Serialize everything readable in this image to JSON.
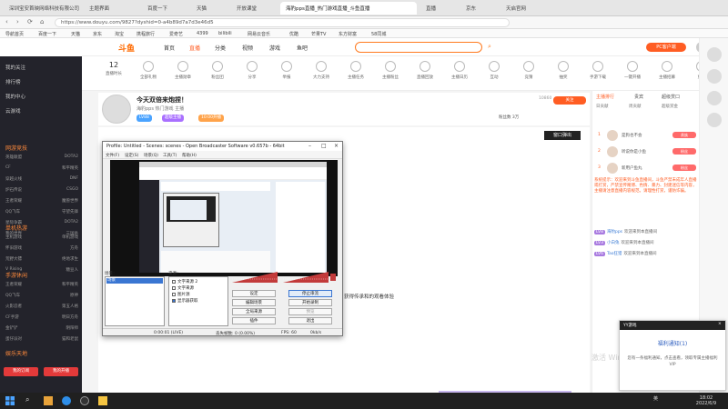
{
  "browser": {
    "tabs": [
      {
        "label": "深圳宝安首映网络科技有限公司"
      },
      {
        "label": "主题界面"
      },
      {
        "label": "百度一下"
      },
      {
        "label": "天猫"
      },
      {
        "label": "开放课堂"
      },
      {
        "label": "海豹pps直播_热门游戏直播_斗鱼直播"
      },
      {
        "label": "直播"
      },
      {
        "label": "京东"
      },
      {
        "label": "天启官网"
      }
    ],
    "url": "https://www.douyu.com/9827?dyshid=0-a4b89d7a7d3e46d5",
    "bookmarks": [
      "导航首页",
      "百度一下",
      "天猫",
      "京东",
      "淘宝",
      "携程旅行",
      "爱奇艺",
      "4399",
      "bilibili",
      "网易云音乐",
      "优酷",
      "芒果TV",
      "东方财富",
      "58同城"
    ]
  },
  "header": {
    "logo": "斗鱼",
    "nav": [
      {
        "label": "首页",
        "active": false
      },
      {
        "label": "直播",
        "active": true
      },
      {
        "label": "分类",
        "active": false
      },
      {
        "label": "视频",
        "active": false
      },
      {
        "label": "游戏",
        "active": false
      },
      {
        "label": "鱼吧",
        "active": false
      }
    ],
    "search_placeholder": "",
    "pc_button": "PC客户端"
  },
  "subnav": {
    "count": "12",
    "items": [
      "直播时长",
      "全部礼物",
      "主播勋章",
      "粉丝团",
      "分享",
      "举报",
      "大力支持",
      "主播任务",
      "主播粉丝",
      "直播回放",
      "主播日历",
      "互动",
      "竞猜",
      "抽奖",
      "手游下载",
      "一键开播",
      "主播招募",
      "更多"
    ]
  },
  "sidebar": {
    "top_items": [
      "我的关注",
      "排行榜",
      "我的中心",
      "云游戏"
    ],
    "section1_title": "网游竞技",
    "section1_pairs": [
      [
        "英雄联盟",
        "DOTA2"
      ],
      [
        "CF",
        "和平精英"
      ],
      [
        "穿越火线",
        "DNF"
      ],
      [
        "炉石传说",
        "CSGO"
      ],
      [
        "王者荣耀",
        "魔兽世界"
      ],
      [
        "QQ飞车",
        "守望先锋"
      ],
      [
        "星际争霸",
        "DOTA2"
      ],
      [
        "我的世界",
        "三国杀"
      ]
    ],
    "section2_title": "单机热游",
    "section2_pairs": [
      [
        "主机游戏",
        "单机游戏"
      ],
      [
        "怀旧游戏",
        "方舟"
      ],
      [
        "荒野大镖",
        "绝地求生"
      ],
      [
        "V Rising",
        "糖豆人"
      ]
    ],
    "section3_title": "手游休闲",
    "section3_pairs": [
      [
        "王者荣耀",
        "和平精英"
      ],
      [
        "QQ飞车",
        "原神"
      ],
      [
        "火影忍者",
        "第五人格"
      ],
      [
        "CF手游",
        "明日方舟"
      ],
      [
        "金铲铲",
        "阴阳师"
      ],
      [
        "蛋仔派对",
        "猫和老鼠"
      ]
    ],
    "section4_title": "娱乐天地",
    "buttons": [
      "我的订阅",
      "我的开播"
    ]
  },
  "room": {
    "title": "今天双倍来炮捏！",
    "meta": "海豹pps  热门游戏  主播",
    "badges": [
      {
        "label": "LV88",
        "color": "#4aa3ff"
      },
      {
        "label": "超级主播",
        "color": "#a970ff"
      },
      {
        "label": "10:00开播",
        "color": "#ffa34a"
      }
    ],
    "follow": "关注",
    "hot": "10860",
    "danmu_button": "窗口弹出",
    "share_label": "粉丝数 3万"
  },
  "obs": {
    "title": "Profile: Untitled - Scenes: scenes - Open Broadcaster Software v0.657b - 64bit",
    "menu": [
      "文件(F)",
      "设定(S)",
      "场景(Q)",
      "工具(T)",
      "帮助(H)"
    ],
    "scenes_label": "场景：",
    "sources_label": "来源：",
    "scene_selected": "场景",
    "sources": [
      {
        "label": "文字来源 2",
        "checked": false
      },
      {
        "label": "文字来源",
        "checked": false
      },
      {
        "label": "图片源",
        "checked": false
      },
      {
        "label": "显示器获取",
        "checked": true
      }
    ],
    "buttons": [
      {
        "label": "设定",
        "highlight": false
      },
      {
        "label": "停止串流",
        "highlight": true
      },
      {
        "label": "编辑场景",
        "highlight": false
      },
      {
        "label": "开始录制",
        "highlight": false
      },
      {
        "label": "全局来源",
        "highlight": false
      },
      {
        "label": "预览",
        "highlight": false
      },
      {
        "label": "插件",
        "highlight": false
      },
      {
        "label": "退出",
        "highlight": false
      }
    ],
    "status": {
      "time": "0:00:01 (LIVE)",
      "dropped": "丢失帧数: 0 (0.00%)",
      "fps": "FPS: 60",
      "kbps": "0kb/s"
    }
  },
  "video_caption": "获得传承和的观看体验",
  "chat": {
    "tabs": [
      "主播排行",
      "贵宾",
      "超级赏口"
    ],
    "rank_tabs": [
      "日贡献",
      "周贡献",
      "超级赏金"
    ],
    "ranks": [
      {
        "name": "是狗也不会",
        "badge": "贵族"
      },
      {
        "name": "听说你是小鱼",
        "badge": "粉丝"
      },
      {
        "name": "新用户鱼丸",
        "badge": "粉丝"
      }
    ],
    "system_message": "系统提示：欢迎来到斗鱼直播间，斗鱼严禁未成年人直播或打赏，严禁宣传赌博、色情、暴力、封建迷信等内容，主播请注意直播内容规范。请理性打赏，谨防诈骗。",
    "lines": [
      {
        "level": "LV8",
        "user": "海豹pps",
        "text": "欢迎来到本直播间"
      },
      {
        "level": "LV3",
        "user": "小白兔",
        "text": "欢迎来到本直播间"
      },
      {
        "level": "LV6",
        "user": "Tao狂猎",
        "text": "欢迎来到本直播间"
      }
    ]
  },
  "popup": {
    "header": "YY游戏",
    "title": "福利通知(1)",
    "body": "您有一条福利通知，点击查看，领取专属主播福利 VIP"
  },
  "watermark": "激活 Windows",
  "taskbar": {
    "tray": "英",
    "time": "18:02",
    "date": "2022/6/9"
  },
  "colors": {
    "accent": "#ff5d23",
    "sidebar_bg": "#23232b",
    "obs_selected": "#3a76d2"
  }
}
